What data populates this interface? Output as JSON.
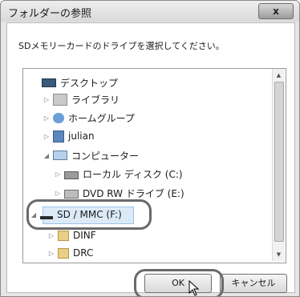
{
  "dialog": {
    "title": "フォルダーの参照",
    "close_label": "x",
    "instruction": "SDメモリーカードのドライブを選択してください。"
  },
  "tree": {
    "items": [
      {
        "label": "デスクトップ",
        "icon": "desktop-icon",
        "expanded": null
      },
      {
        "label": "ライブラリ",
        "icon": "library-icon",
        "expanded": false
      },
      {
        "label": "ホームグループ",
        "icon": "homegroup-icon",
        "expanded": false
      },
      {
        "label": "julian",
        "icon": "user-folder-icon",
        "expanded": false
      },
      {
        "label": "コンピューター",
        "icon": "computer-icon",
        "expanded": true
      },
      {
        "label": "ローカル ディスク (C:)",
        "icon": "hard-drive-icon",
        "expanded": false
      },
      {
        "label": "DVD RW ドライブ (E:)",
        "icon": "dvd-drive-icon",
        "expanded": false
      },
      {
        "label": "SD / MMC (F:)",
        "icon": "sd-card-drive-icon",
        "expanded": true,
        "selected": true
      },
      {
        "label": "DINF",
        "icon": "folder-icon",
        "expanded": false
      },
      {
        "label": "DRC",
        "icon": "folder-icon",
        "expanded": false
      }
    ]
  },
  "buttons": {
    "ok_label": "OK",
    "cancel_label": "キャンセル"
  },
  "colors": {
    "selection": "#dceaf8",
    "callout": "#6a6a6a"
  }
}
